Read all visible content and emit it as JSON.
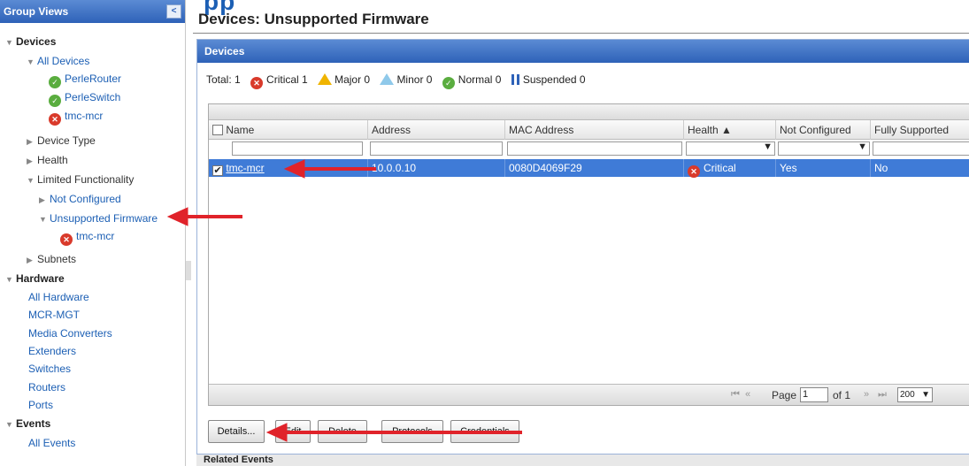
{
  "top_cut_title": "pp",
  "sidebar": {
    "header": "Group Views",
    "collapse_glyph": "<",
    "tree": [
      {
        "label": "Devices"
      },
      {
        "label": "All Devices"
      },
      {
        "label": "PerleRouter",
        "status": "normal"
      },
      {
        "label": "PerleSwitch",
        "status": "normal"
      },
      {
        "label": "tmc-mcr",
        "status": "critical"
      },
      {
        "label": "Device Type"
      },
      {
        "label": "Health"
      },
      {
        "label": "Limited Functionality"
      },
      {
        "label": "Not Configured"
      },
      {
        "label": "Unsupported Firmware"
      },
      {
        "label": "tmc-mcr",
        "status": "critical"
      },
      {
        "label": "Subnets"
      },
      {
        "label": "Hardware"
      },
      {
        "label": "All Hardware"
      },
      {
        "label": "MCR-MGT"
      },
      {
        "label": "Media Converters"
      },
      {
        "label": "Extenders"
      },
      {
        "label": "Switches"
      },
      {
        "label": "Routers"
      },
      {
        "label": "Ports"
      },
      {
        "label": "Events"
      },
      {
        "label": "All Events"
      }
    ]
  },
  "page": {
    "title": "Devices: Unsupported Firmware"
  },
  "panel": {
    "header": "Devices",
    "summary": {
      "total": "Total: 1",
      "critical": "Critical 1",
      "major": "Major 0",
      "minor": "Minor 0",
      "normal": "Normal 0",
      "suspended": "Suspended 0"
    },
    "columns": [
      "Name",
      "Address",
      "MAC Address",
      "Health ▲",
      "Not Configured",
      "Fully Supported"
    ],
    "rows": [
      {
        "name": "tmc-mcr",
        "address": "10.0.0.10",
        "mac": "0080D4069F29",
        "health": "Critical",
        "not_configured": "Yes",
        "fully_supported": "No",
        "checked": true
      }
    ],
    "pager": {
      "first": "⏮",
      "prev": "«",
      "page_label": "Page",
      "page_value": "1",
      "of_label": "of 1",
      "next": "»",
      "last": "⏭",
      "page_size": "200"
    },
    "buttons": [
      "Details...",
      "Edit",
      "Delete",
      "Protocols",
      "Credentials"
    ]
  },
  "related_events": "Related Events",
  "colors": {
    "accent": "#2e62b8",
    "selected_row": "#3f7bd7",
    "critical": "#d93a2b",
    "normal": "#5aad3f",
    "annotation": "#e0232a"
  }
}
